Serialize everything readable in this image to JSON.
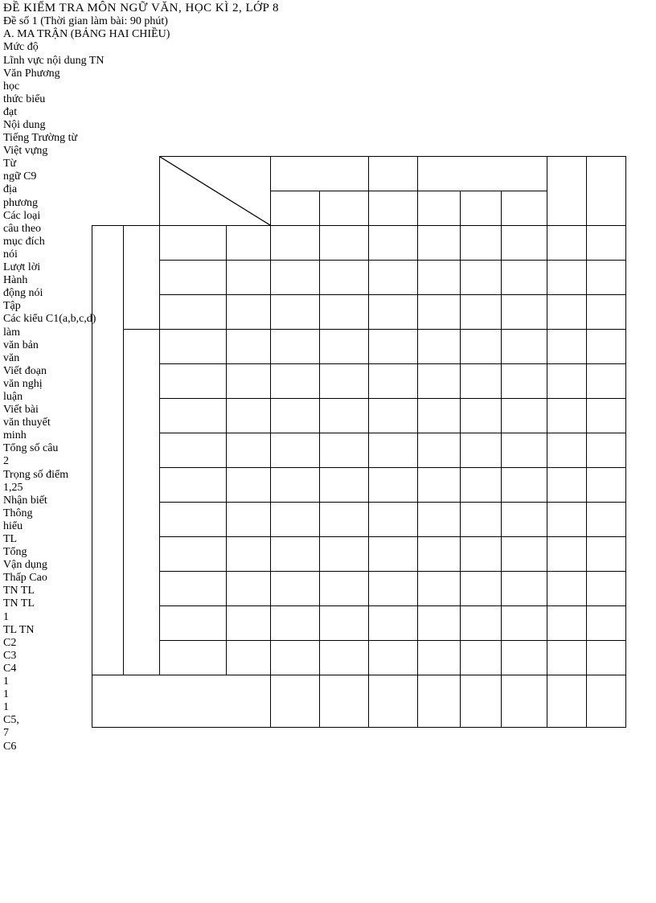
{
  "header": {
    "title": "ĐỀ KIỂM TRA MÔN NGỮ VĂN, HỌC KÌ 2, LỚP 8",
    "sub1": "Đề số 1 (Thời gian làm bài: 90 phút)",
    "sub2": "A. MA TRẬN (BẢNG HAI CHIỀU)"
  },
  "left_lines": [
    "Mức độ",
    "Lĩnh vực nội dung TN",
    "Văn Phương",
    "học",
    "thức biểu",
    "đạt",
    "Nội dung",
    "Tiếng Trường từ",
    "Việt vựng",
    "Từ",
    "ngữ C9",
    "địa",
    "phương",
    "Các loại",
    "câu theo",
    "mục đích",
    "nói",
    "Lượt lời",
    "Hành",
    "động nói",
    "Tập",
    "Các kiểu C1(a,b,c,d)",
    "làm",
    "văn bản",
    "văn",
    "Viết đoạn",
    "văn nghị",
    "luận",
    "Viết bài",
    "văn thuyết",
    "minh",
    "Tổng số câu",
    "2",
    "Trọng số điểm",
    "1,25",
    "Nhận biết",
    "Thông",
    "hiểu",
    "TL",
    "Tổng",
    "Vận dụng",
    "Thấp Cao",
    "TN TL",
    "TN TL",
    "1",
    "TL TN",
    "C2",
    "C3",
    "C4",
    "1",
    "1",
    "1",
    "C5,",
    "7",
    "C6"
  ],
  "chart_data": {
    "type": "table",
    "title": "MA TRẬN (BẢNG HAI CHIỀU)",
    "note": "Two-dimensional assessment matrix grid. Column headers (Mức độ / levels) include: Nhận biết, Thông hiểu, Vận dụng Thấp, Vận dụng Cao, Tổng — each split into TN and TL sub-columns. Row groups (Lĩnh vực nội dung) include: Văn học (Phương thức biểu đạt, Nội dung), Tiếng Việt (Trường từ vựng, Từ ngữ địa phương C9, Các loại câu theo mục đích nói, Lượt lời, Hành động nói), Tập làm văn (Các kiểu văn bản C1(a,b,c,d), Viết đoạn văn nghị luận, Viết bài văn thuyết minh), Tổng số câu 2, Trọng số điểm 1,25. Visible grid in image is blank (no cell values rendered inside the table area).",
    "columns": [
      "Nhận biết TN",
      "Nhận biết TL",
      "Thông hiểu TN",
      "Thông hiểu TL",
      "Vận dụng Thấp TN",
      "Vận dụng Thấp TL",
      "Vận dụng Cao TN",
      "Vận dụng Cao TL",
      "Tổng TL",
      "Tổng TN"
    ],
    "rows": [],
    "extra_codes": [
      "C1(a,b,c,d)",
      "C2",
      "C3",
      "C4",
      "C5",
      "C6",
      "C9",
      "7",
      "1",
      "1",
      "1",
      "1"
    ]
  }
}
